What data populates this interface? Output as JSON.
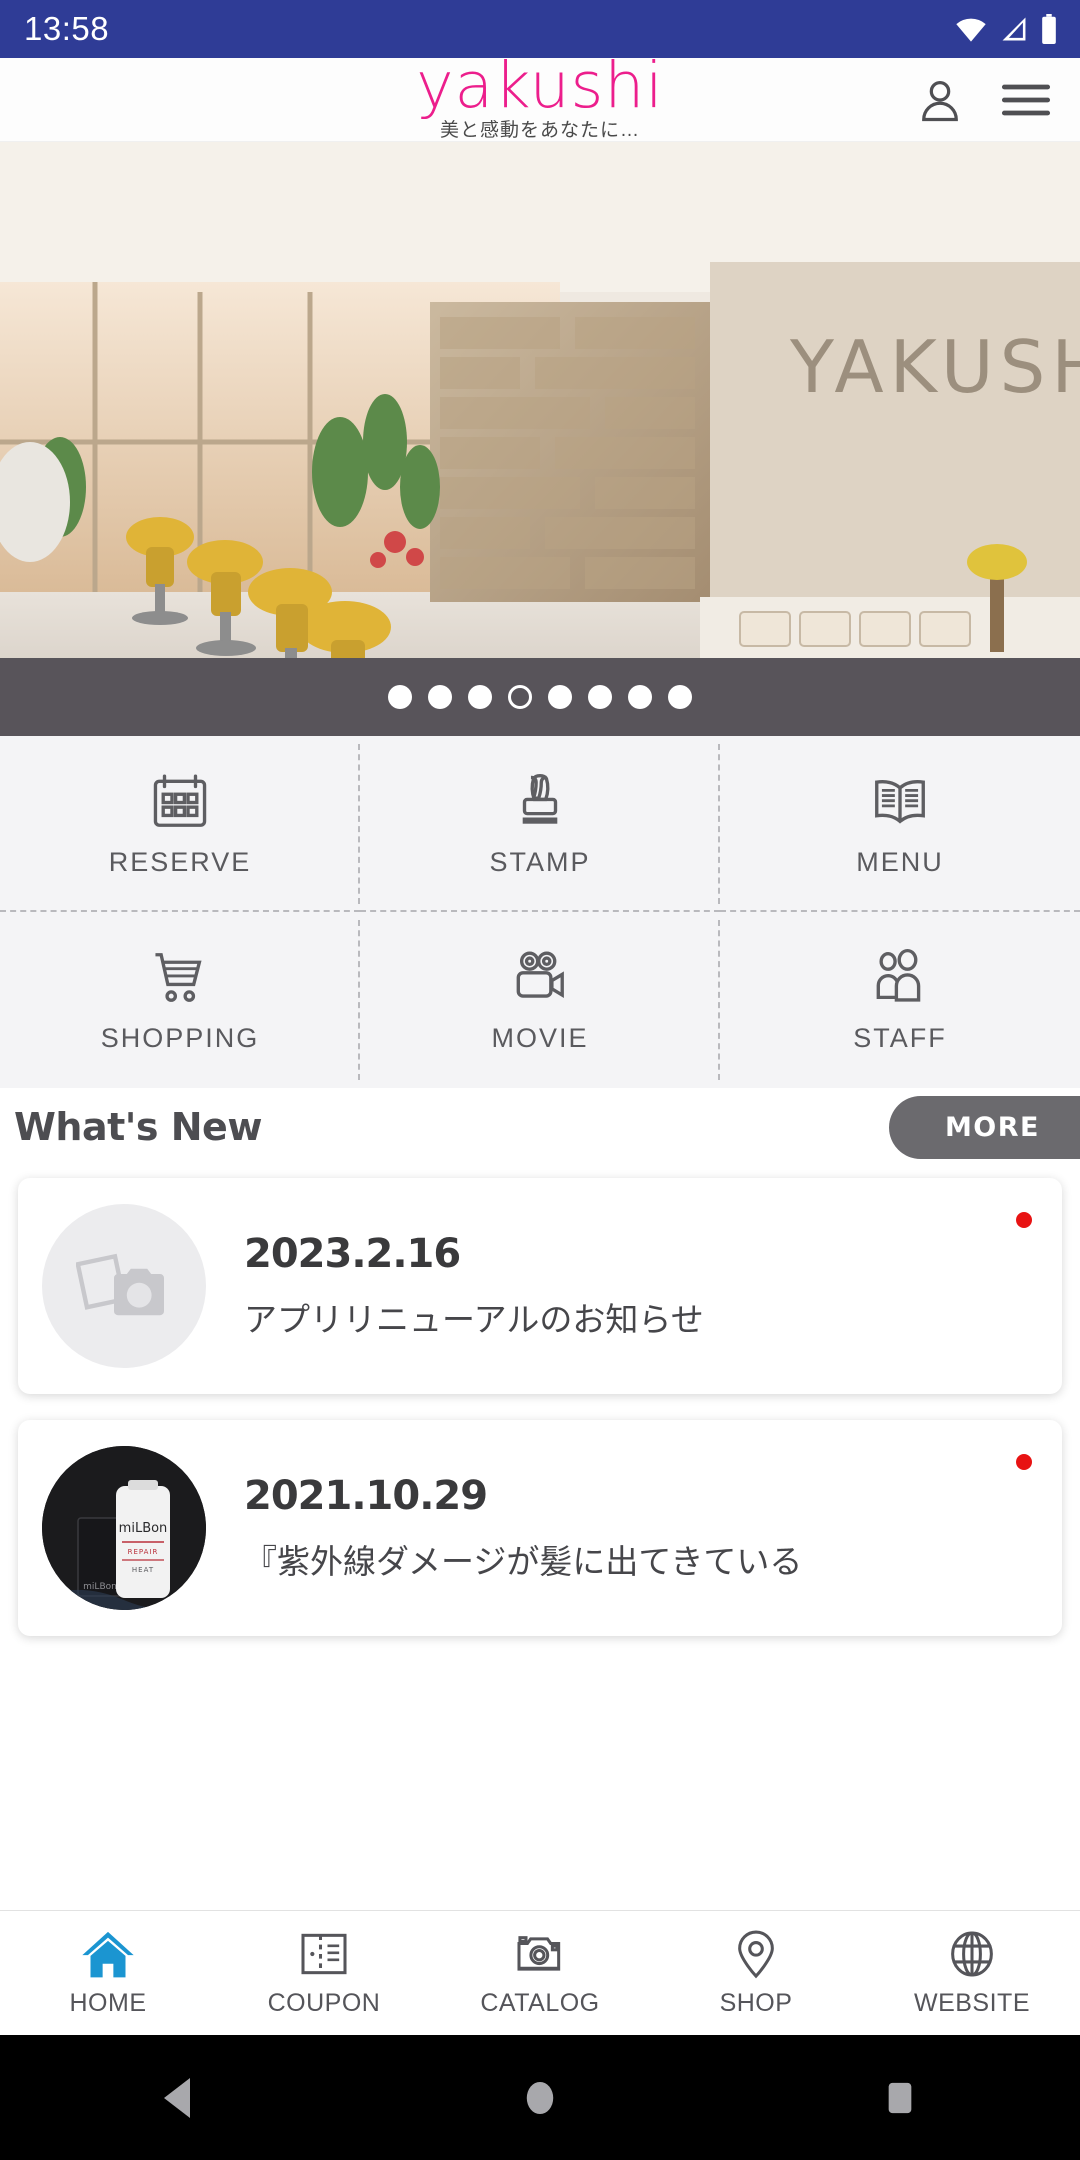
{
  "status_bar": {
    "time": "13:58",
    "icons": [
      "wifi-icon",
      "signal-icon",
      "battery-icon"
    ],
    "background": "#2f3c96"
  },
  "header": {
    "logo_text": "yakushi",
    "logo_color": "#ec1e8c",
    "tagline": "美と感動をあなたに…",
    "account_icon": "person-icon",
    "menu_icon": "hamburger-menu-icon"
  },
  "hero": {
    "alt": "salon interior with yellow styling chairs and stone wall",
    "dots_total": 8,
    "active_dot_index": 4
  },
  "grid_menu": [
    {
      "label": "RESERVE",
      "icon": "calendar-icon"
    },
    {
      "label": "STAMP",
      "icon": "stamp-icon"
    },
    {
      "label": "MENU",
      "icon": "open-book-icon"
    },
    {
      "label": "SHOPPING",
      "icon": "shopping-cart-icon"
    },
    {
      "label": "MOVIE",
      "icon": "video-camera-icon"
    },
    {
      "label": "STAFF",
      "icon": "people-icon"
    }
  ],
  "news": {
    "title": "What's New",
    "more_label": "MORE",
    "items": [
      {
        "date": "2023.2.16",
        "text": "アプリリニューアルのお知らせ",
        "thumb": "photo-placeholder-icon",
        "unread": true
      },
      {
        "date": "2021.10.29",
        "text": "『紫外線ダメージが髪に出てきている",
        "thumb": "milbon-product-photo",
        "thumb_brand": "miLBon",
        "thumb_caption": "REPAIR HEAT",
        "unread": true
      }
    ]
  },
  "tab_bar": {
    "active": "HOME",
    "active_color": "#1b95d1",
    "items": [
      {
        "label": "HOME",
        "icon": "home-icon"
      },
      {
        "label": "COUPON",
        "icon": "coupon-icon"
      },
      {
        "label": "CATALOG",
        "icon": "camera-icon"
      },
      {
        "label": "SHOP",
        "icon": "map-pin-icon"
      },
      {
        "label": "WEBSITE",
        "icon": "globe-icon"
      }
    ]
  },
  "android_nav": {
    "back": "back-triangle-icon",
    "home": "home-circle-icon",
    "recents": "recents-square-icon"
  }
}
